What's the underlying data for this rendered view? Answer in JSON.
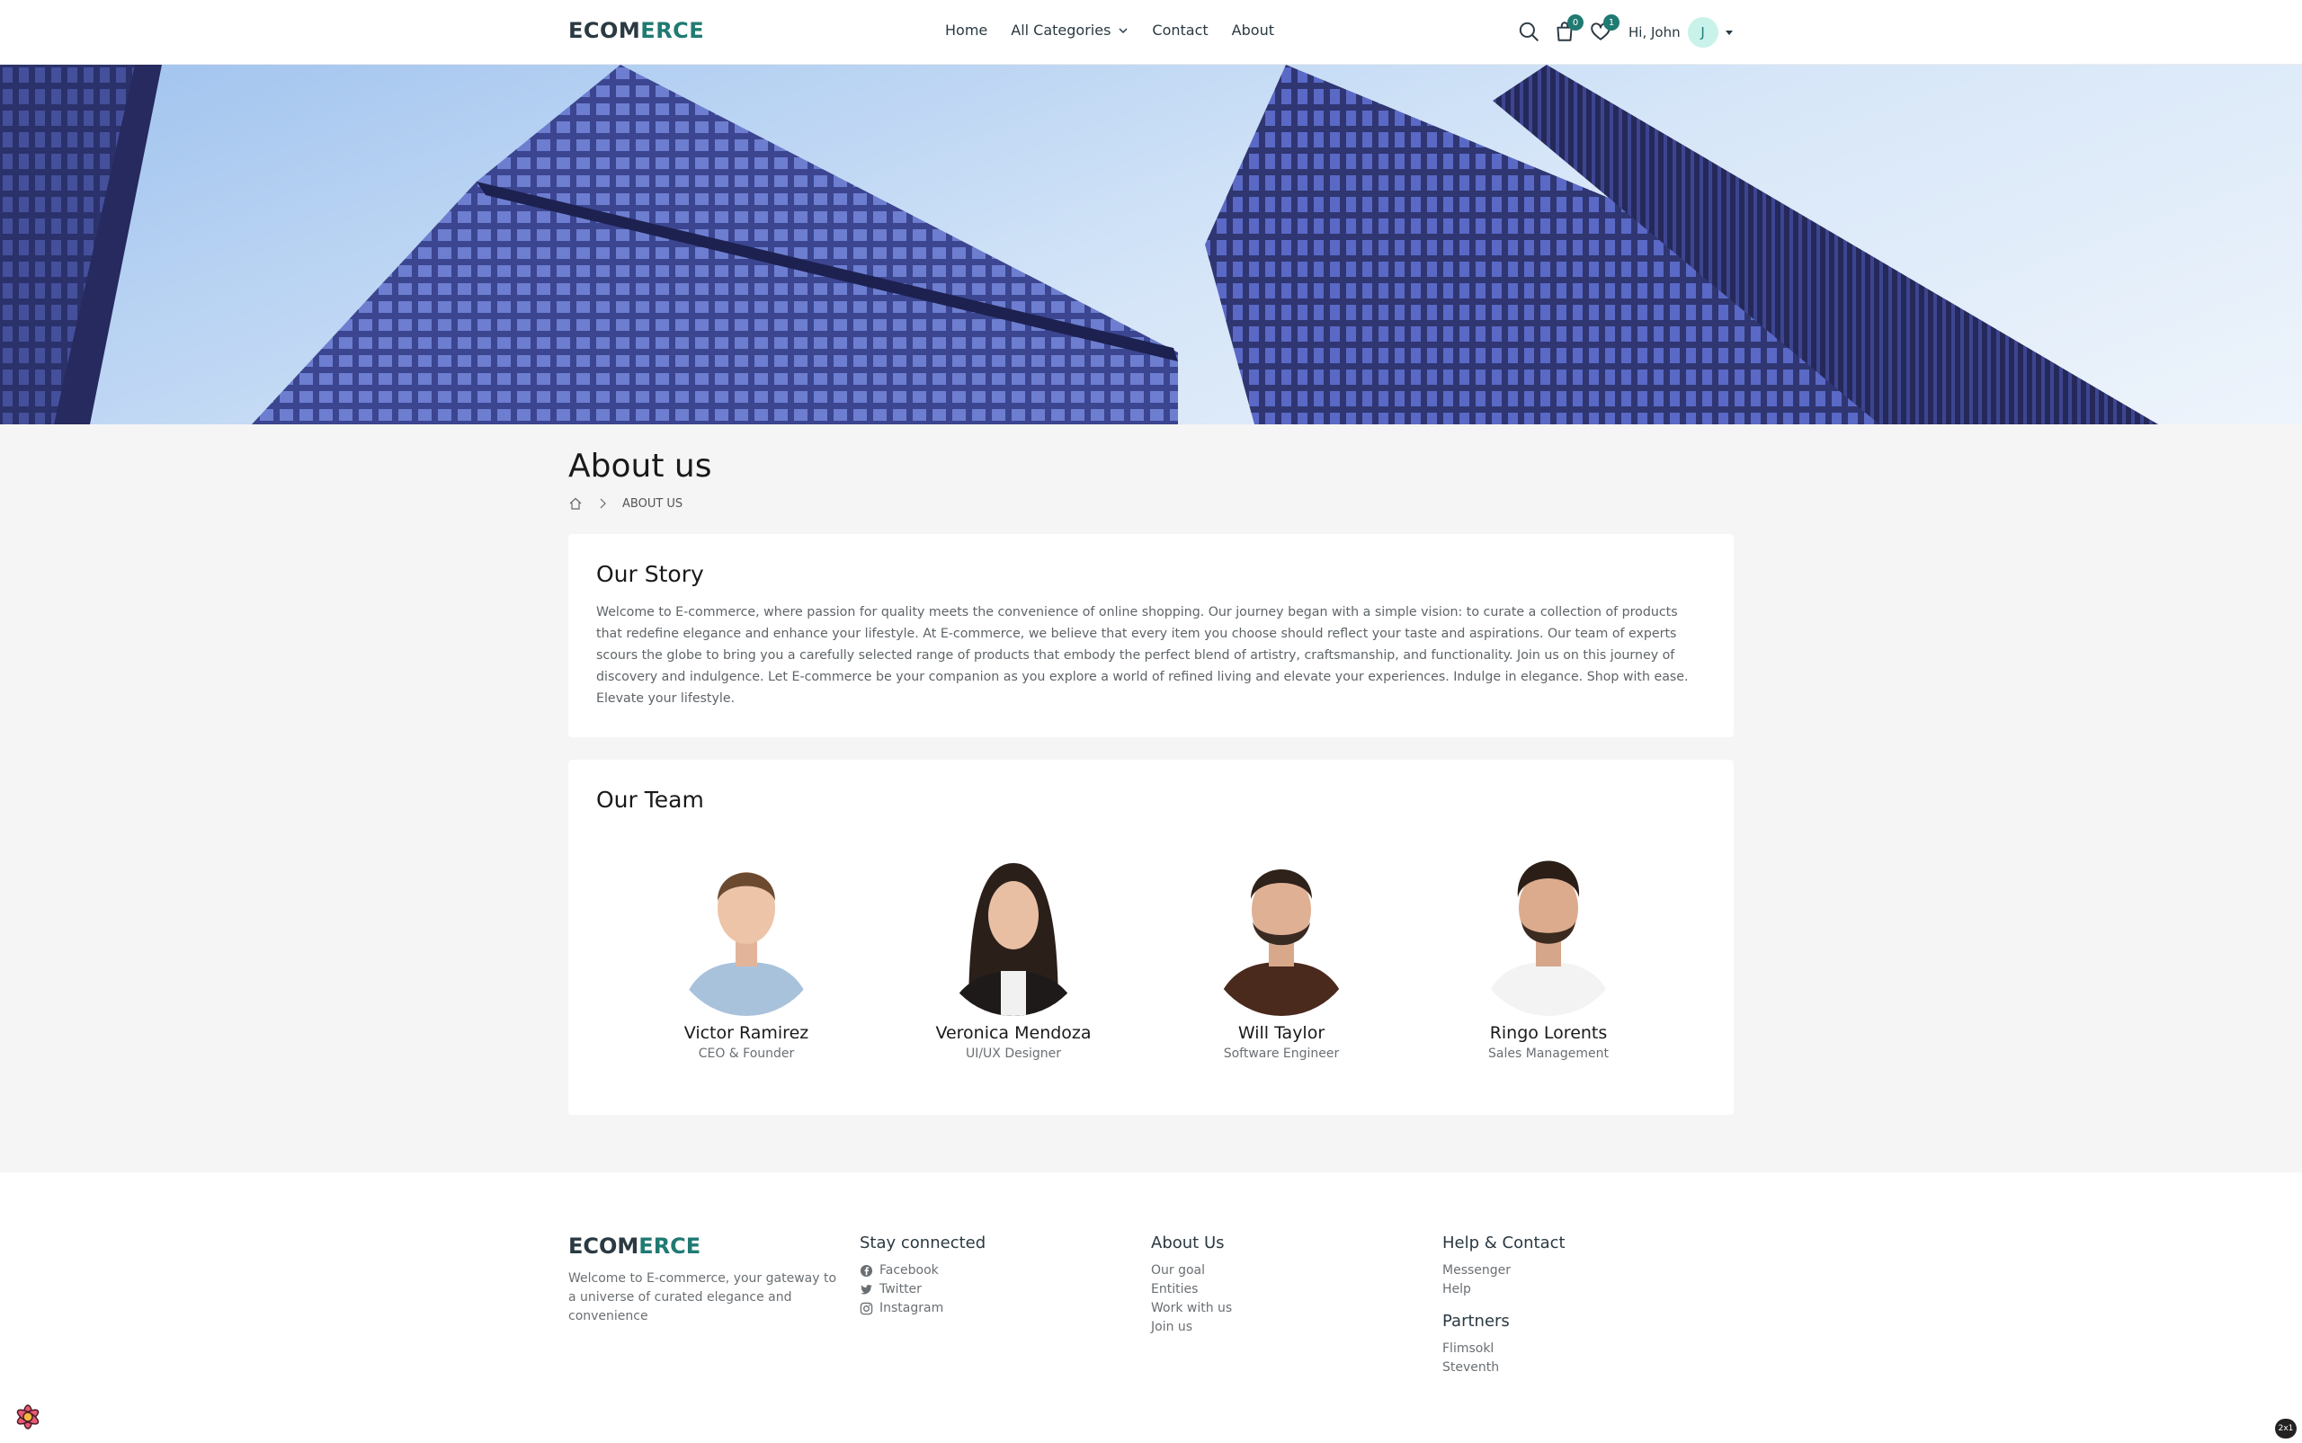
{
  "brand": {
    "part1": "ECOM",
    "part2": "ERCE"
  },
  "nav": [
    {
      "label": "Home"
    },
    {
      "label": "All Categories"
    },
    {
      "label": "Contact"
    },
    {
      "label": "About"
    }
  ],
  "header": {
    "cart_count": "0",
    "wishlist_count": "1",
    "greeting": "Hi, John",
    "avatar_initial": "J"
  },
  "page": {
    "title": "About us",
    "breadcrumb_current": "ABOUT US"
  },
  "story": {
    "heading": "Our Story",
    "text": "Welcome to E-commerce, where passion for quality meets the convenience of online shopping. Our journey began with a simple vision: to curate a collection of products that redefine elegance and enhance your lifestyle. At E-commerce, we believe that every item you choose should reflect your taste and aspirations. Our team of experts scours the globe to bring you a carefully selected range of products that embody the perfect blend of artistry, craftsmanship, and functionality. Join us on this journey of discovery and indulgence. Let E-commerce be your companion as you explore a world of refined living and elevate your experiences. Indulge in elegance. Shop with ease. Elevate your lifestyle."
  },
  "team": {
    "heading": "Our Team",
    "members": [
      {
        "name": "Victor Ramirez",
        "role": "CEO & Founder"
      },
      {
        "name": "Veronica Mendoza",
        "role": "UI/UX Designer"
      },
      {
        "name": "Will Taylor",
        "role": "Software Engineer"
      },
      {
        "name": "Ringo Lorents",
        "role": "Sales Management"
      }
    ]
  },
  "footer": {
    "tagline": "Welcome to E-commerce, your gateway to a universe of curated elegance and convenience",
    "stay_connected": {
      "heading": "Stay connected",
      "links": [
        "Facebook",
        "Twitter",
        "Instagram"
      ]
    },
    "about_us": {
      "heading": "About Us",
      "links": [
        "Our goal",
        "Entities",
        "Work with us",
        "Join us"
      ]
    },
    "help_contact": {
      "heading": "Help & Contact",
      "links": [
        "Messenger",
        "Help"
      ]
    },
    "partners": {
      "heading": "Partners",
      "links": [
        "Flimsokl",
        "Steventh"
      ]
    }
  },
  "corner_badge": "2x1",
  "colors": {
    "accent": "#1f7a72",
    "dark": "#2a3942",
    "bg": "#f5f5f5"
  }
}
